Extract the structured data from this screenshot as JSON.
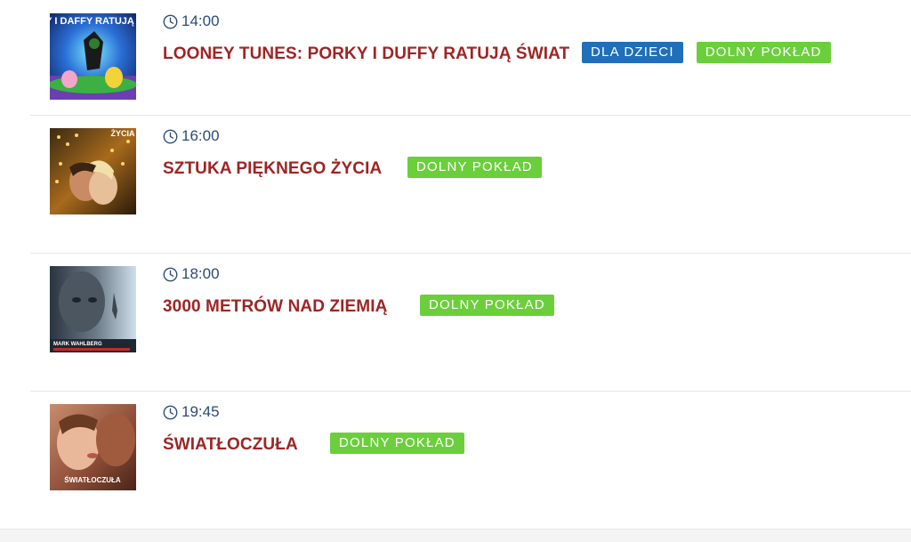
{
  "schedule": [
    {
      "time": "14:00",
      "title": "LOONEY TUNES: PORKY I DUFFY RATUJĄ ŚWIAT",
      "poster_icon": "looney-tunes-poster",
      "poster_text": "PORKY I DAFFY RATUJĄ ŚWIAT",
      "tags": [
        {
          "label": "DLA DZIECI",
          "color": "#1f6fba"
        },
        {
          "label": "DOLNY POKŁAD",
          "color": "#6bcf3c"
        }
      ]
    },
    {
      "time": "16:00",
      "title": "SZTUKA PIĘKNEGO ŻYCIA",
      "poster_icon": "sztuka-pieknego-zycia-poster",
      "poster_text": "ŻYCIA",
      "tags": [
        {
          "label": "DOLNY POKŁAD",
          "color": "#6bcf3c"
        }
      ]
    },
    {
      "time": "18:00",
      "title": "3000 METRÓW NAD ZIEMIĄ",
      "poster_icon": "3000-metrow-poster",
      "poster_text": "MARK WAHLBERG",
      "tags": [
        {
          "label": "DOLNY POKŁAD",
          "color": "#6bcf3c"
        }
      ]
    },
    {
      "time": "19:45",
      "title": "ŚWIATŁOCZUŁA",
      "poster_icon": "swiatloczula-poster",
      "poster_text": "ŚWIATŁOCZUŁA",
      "tags": [
        {
          "label": "DOLNY POKŁAD",
          "color": "#6bcf3c"
        }
      ]
    }
  ],
  "colors": {
    "title": "#9e2424",
    "time": "#2c4a7a",
    "tag_blue": "#1f6fba",
    "tag_green": "#6bcf3c"
  }
}
